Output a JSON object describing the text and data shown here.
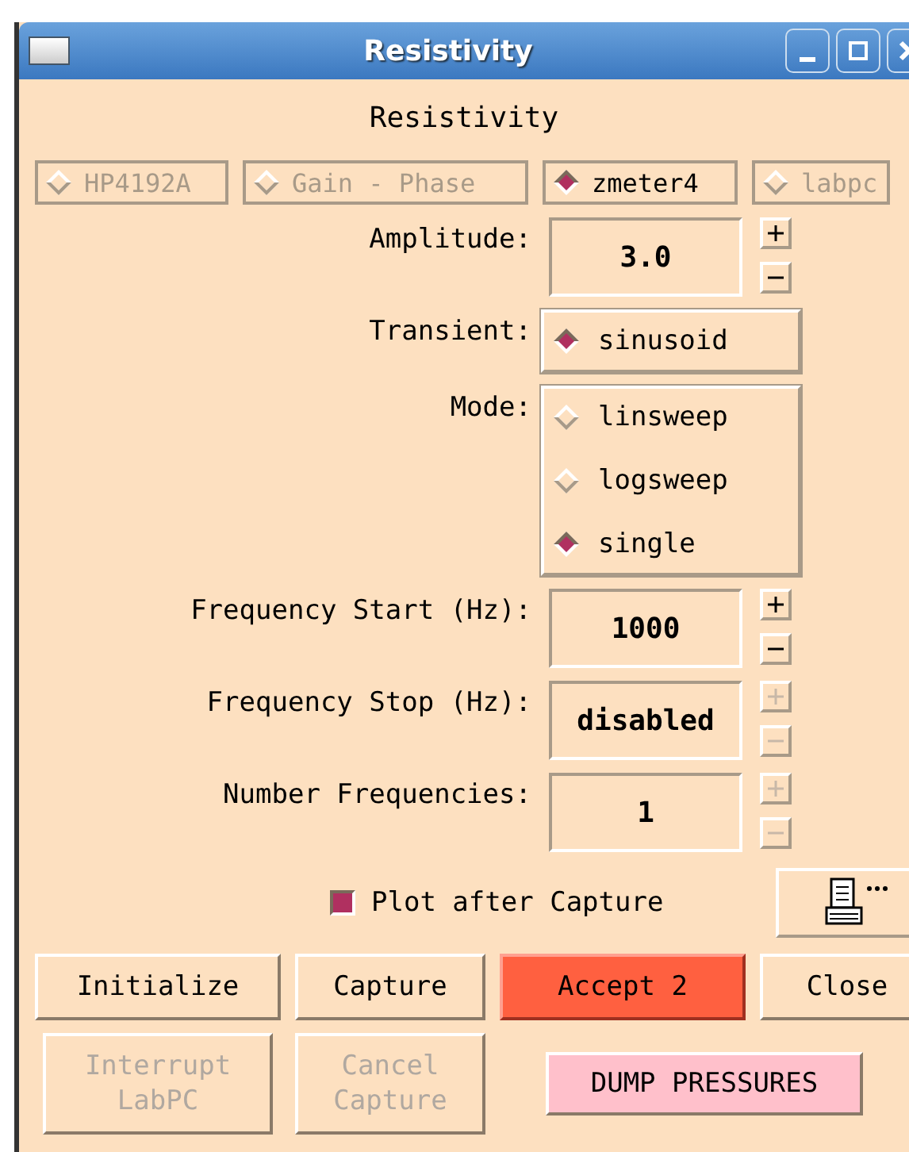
{
  "window": {
    "title": "Resistivity"
  },
  "heading": "Resistivity",
  "instruments": [
    {
      "label": "HP4192A",
      "selected": false,
      "disabled": true
    },
    {
      "label": "Gain - Phase",
      "selected": false,
      "disabled": true
    },
    {
      "label": "zmeter4",
      "selected": true,
      "disabled": false
    },
    {
      "label": "labpc",
      "selected": false,
      "disabled": true
    }
  ],
  "rows": [
    {
      "kind": "spin",
      "label": "Amplitude:",
      "value": "3.0",
      "spinner_disabled": false
    },
    {
      "kind": "radio",
      "label": "Transient:",
      "options": [
        {
          "label": "sinusoid",
          "selected": true
        }
      ]
    },
    {
      "kind": "radio",
      "label": "Mode:",
      "options": [
        {
          "label": "linsweep",
          "selected": false
        },
        {
          "label": "logsweep",
          "selected": false
        },
        {
          "label": "single",
          "selected": true
        }
      ]
    },
    {
      "kind": "spin",
      "label": "Frequency Start (Hz):",
      "value": "1000",
      "spinner_disabled": false
    },
    {
      "kind": "spin",
      "label": "Frequency Stop (Hz):",
      "value": "disabled",
      "spinner_disabled": true
    },
    {
      "kind": "spin",
      "label": "Number Frequencies:",
      "value": "1",
      "spinner_disabled": true
    }
  ],
  "plot_after_capture": {
    "label": "Plot after Capture",
    "checked": true
  },
  "buttons": [
    {
      "label": "Initialize",
      "kind": "normal",
      "disabled": false
    },
    {
      "label": "Capture",
      "kind": "normal",
      "disabled": false
    },
    {
      "label": "Accept 2",
      "kind": "accent",
      "disabled": false
    },
    {
      "label": "Close",
      "kind": "normal",
      "disabled": false
    }
  ],
  "buttons_2": [
    {
      "label": "Interrupt LabPC",
      "kind": "normal",
      "disabled": true
    },
    {
      "label": "Cancel Capture",
      "kind": "normal",
      "disabled": true
    },
    {
      "label": "DUMP PRESSURES",
      "kind": "pink",
      "disabled": false
    }
  ]
}
